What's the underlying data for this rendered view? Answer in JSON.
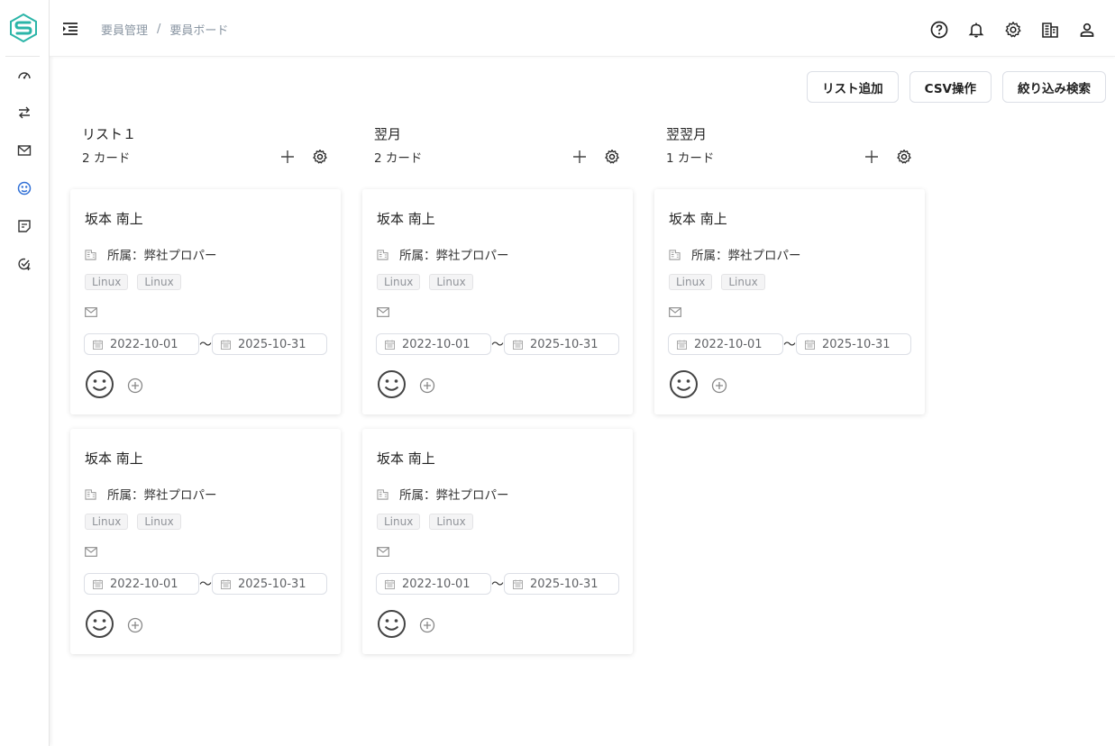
{
  "sidebar": {
    "logo": "logo-icon",
    "items": [
      {
        "icon": "dashboard-icon"
      },
      {
        "icon": "transfer-icon"
      },
      {
        "icon": "mail-icon"
      },
      {
        "icon": "board-icon",
        "active": true
      },
      {
        "icon": "note-icon"
      },
      {
        "icon": "task-check-icon"
      }
    ]
  },
  "header": {
    "breadcrumb": [
      "要員管理",
      "要員ボード"
    ],
    "breadcrumb_separator": "/",
    "icons": [
      "help-icon",
      "bell-icon",
      "settings-icon",
      "company-icon",
      "user-icon"
    ]
  },
  "toolbar": {
    "add_list": "リスト追加",
    "csv": "CSV操作",
    "filter_search": "絞り込み検索"
  },
  "colors": {
    "accent": "#2f6fd6",
    "logo": "#2bb5a8",
    "breadcrumb": "#8a96a3"
  },
  "columns": [
    {
      "title": "リスト１",
      "count": "2 カード",
      "cards": [
        {
          "name": "坂本 南上",
          "affiliation": "所属：弊社プロパー",
          "tags": [
            "Linux",
            "Linux"
          ],
          "start": "2022-10-01",
          "end": "2025-10-31"
        },
        {
          "name": "坂本 南上",
          "affiliation": "所属：弊社プロパー",
          "tags": [
            "Linux",
            "Linux"
          ],
          "start": "2022-10-01",
          "end": "2025-10-31"
        }
      ]
    },
    {
      "title": "翌月",
      "count": "2 カード",
      "cards": [
        {
          "name": "坂本 南上",
          "affiliation": "所属：弊社プロパー",
          "tags": [
            "Linux",
            "Linux"
          ],
          "start": "2022-10-01",
          "end": "2025-10-31"
        },
        {
          "name": "坂本 南上",
          "affiliation": "所属：弊社プロパー",
          "tags": [
            "Linux",
            "Linux"
          ],
          "start": "2022-10-01",
          "end": "2025-10-31"
        }
      ]
    },
    {
      "title": "翌翌月",
      "count": "1 カード",
      "cards": [
        {
          "name": "坂本 南上",
          "affiliation": "所属：弊社プロパー",
          "tags": [
            "Linux",
            "Linux"
          ],
          "start": "2022-10-01",
          "end": "2025-10-31"
        }
      ]
    }
  ],
  "date_separator": "〜"
}
